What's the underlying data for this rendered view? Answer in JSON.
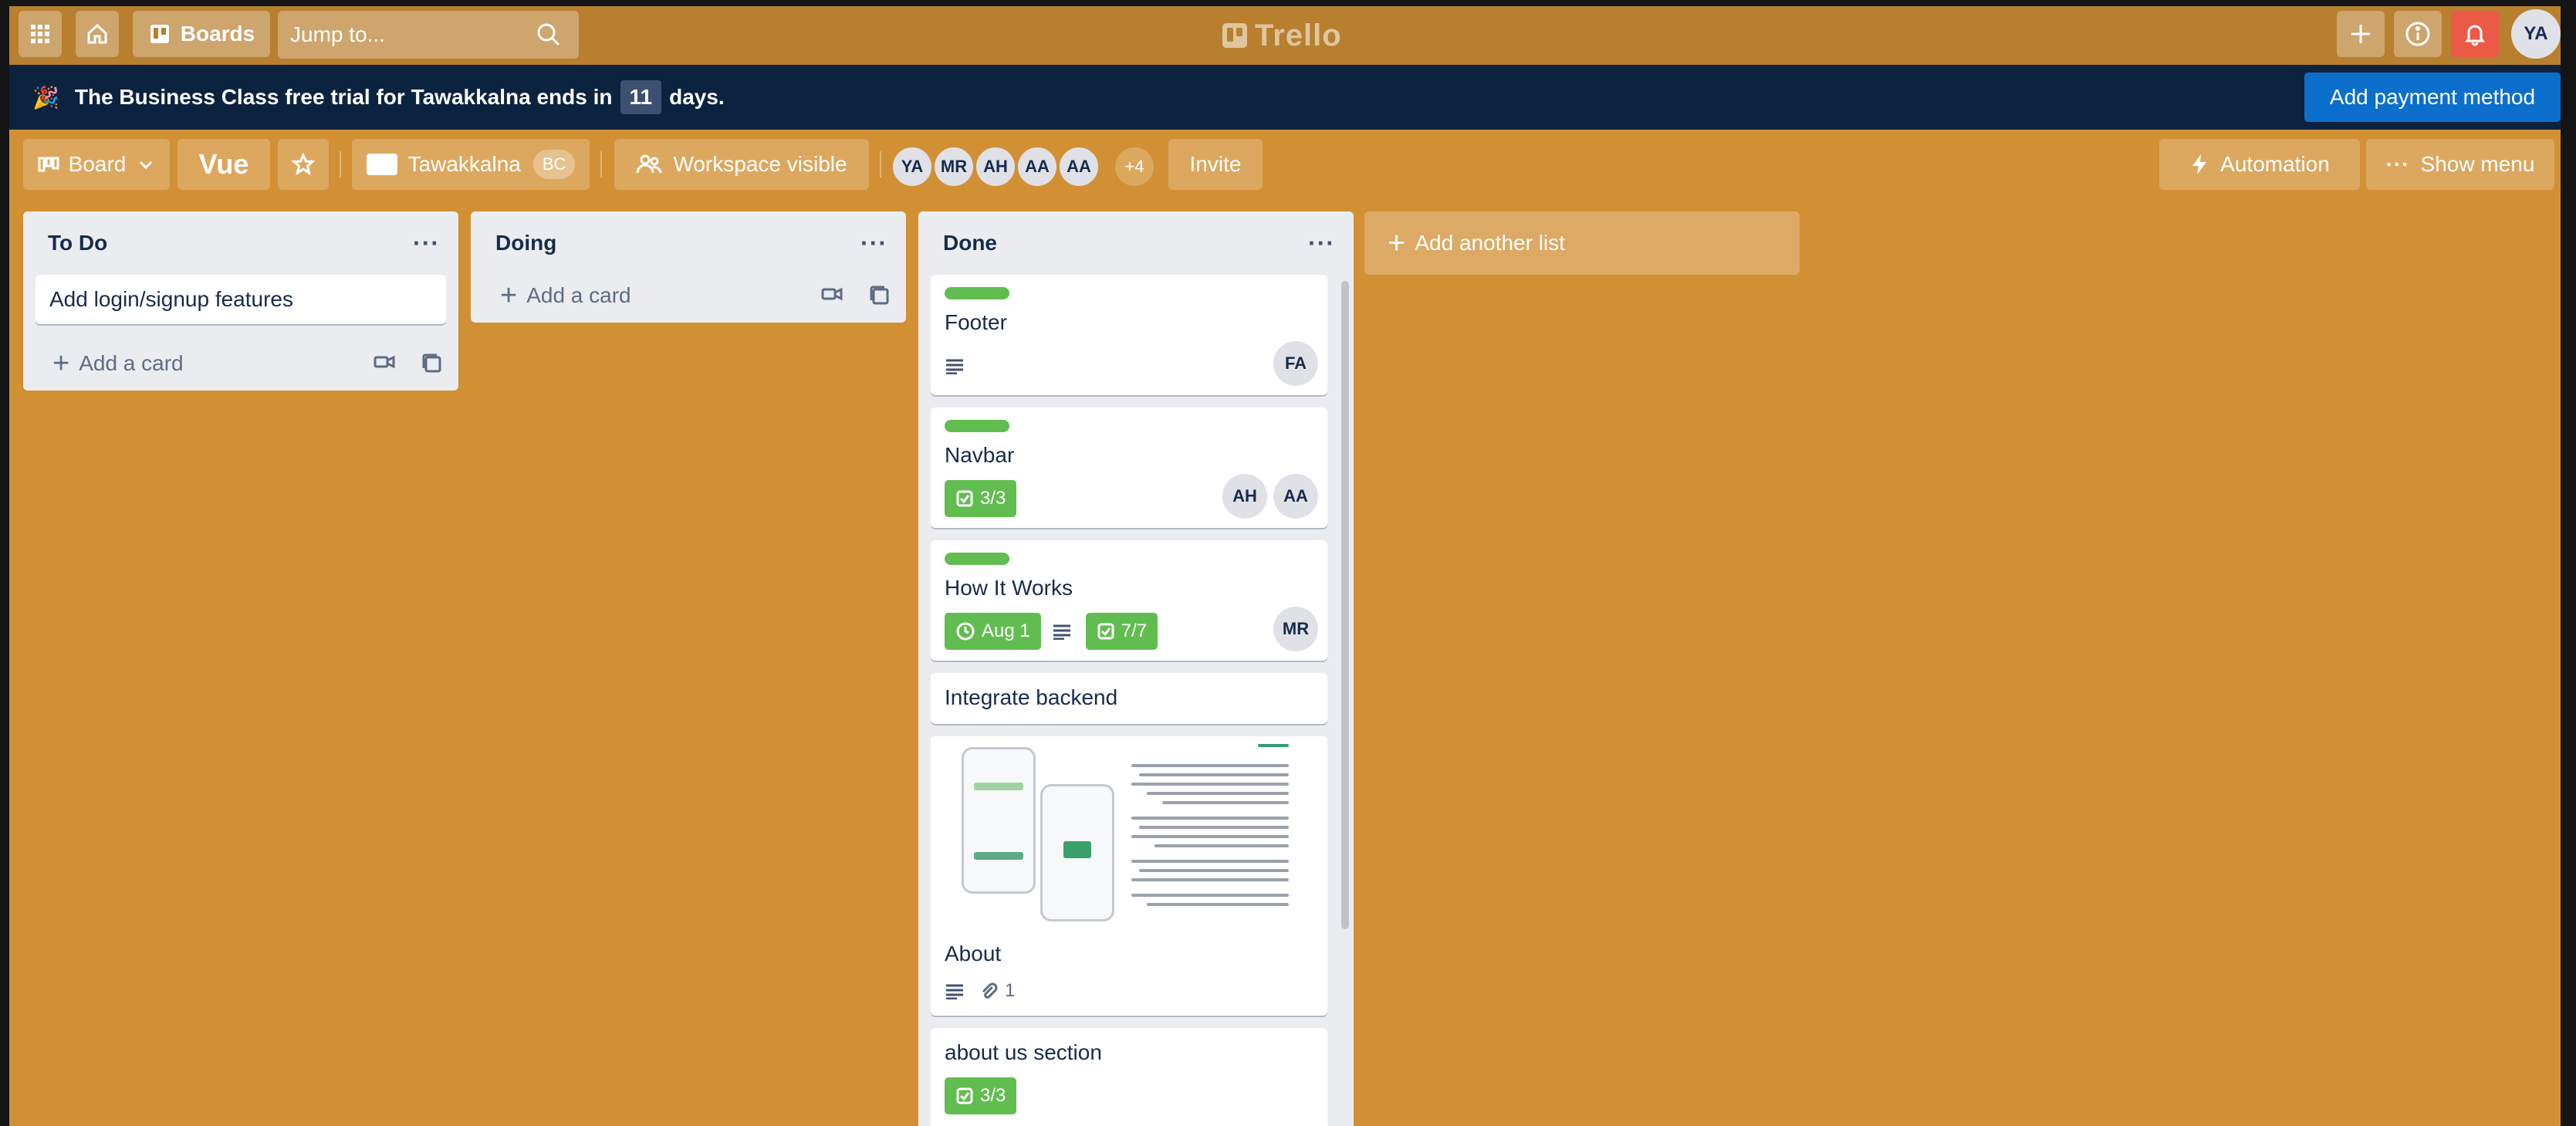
{
  "nav": {
    "boards_label": "Boards",
    "search_placeholder": "Jump to...",
    "logo_text": "Trello",
    "user_initials": "YA"
  },
  "banner": {
    "text_before": "The Business Class free trial for Tawakkalna ends in",
    "days": "11",
    "text_after": "days.",
    "button": "Add payment method"
  },
  "board_header": {
    "view_label": "Board",
    "board_name": "Vue",
    "workspace_name": "Tawakkalna",
    "workspace_badge": "BC",
    "visibility_label": "Workspace visible",
    "members": [
      "YA",
      "MR",
      "AH",
      "AA",
      "AA"
    ],
    "more_members": "+4",
    "invite_label": "Invite",
    "automation_label": "Automation",
    "show_menu_label": "Show menu"
  },
  "lists": [
    {
      "title": "To Do",
      "cards": [
        {
          "title": "Add login/signup features"
        }
      ],
      "add_card_label": "Add a card"
    },
    {
      "title": "Doing",
      "cards": [],
      "add_card_label": "Add a card"
    },
    {
      "title": "Done",
      "cards": [
        {
          "title": "Footer",
          "label_color": "#61bd4f",
          "members": [
            "FA"
          ]
        },
        {
          "title": "Navbar",
          "label_color": "#61bd4f",
          "checklist": "3/3",
          "members": [
            "AH",
            "AA"
          ]
        },
        {
          "title": "How It Works",
          "label_color": "#61bd4f",
          "due": "Aug 1",
          "checklist": "7/7",
          "members": [
            "MR"
          ]
        },
        {
          "title": "Integrate backend"
        },
        {
          "title": "About",
          "attachments": "1"
        },
        {
          "title": "about us section",
          "checklist": "3/3"
        }
      ]
    }
  ],
  "add_list_label": "Add another list",
  "colors": {
    "board_bg": "#d29034",
    "nav_bg": "#b87f2e",
    "banner_bg": "#0c2340",
    "label_green": "#61bd4f",
    "pay_button": "#0c6fcc",
    "notification": "#eb5a46"
  }
}
